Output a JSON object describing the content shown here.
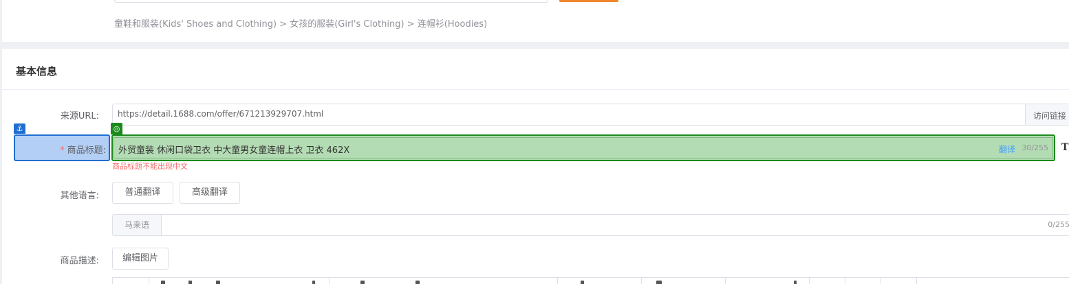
{
  "breadcrumb": "童鞋和服装(Kids' Shoes and Clothing) > 女孩的服装(Girl's Clothing) > 连帽衫(Hoodies)",
  "section": {
    "title": "基本信息"
  },
  "source_url": {
    "label": "来源URL:",
    "value": "https://detail.1688.com/offer/671213929707.html",
    "visit_button": "访问链接"
  },
  "product_title": {
    "required_mark": "*",
    "label": "商品标题:",
    "value": "外贸童装 休闲口袋卫衣 中大童男女童连帽上衣 卫衣 462X",
    "translate": "翻译",
    "count": "30/255",
    "tool_icon": "T",
    "error": "商品标题不能出现中文",
    "anchor_badge": "⚓",
    "target_badge": "◎"
  },
  "other_languages": {
    "label": "其他语言:",
    "normal_translate": "普通翻译",
    "advanced_translate": "高级翻译",
    "language_name": "马来语",
    "language_count": "0/255"
  },
  "description": {
    "label": "商品描述:",
    "edit_images": "编辑图片"
  },
  "colors": {
    "accent_orange": "#f0852d",
    "highlight_blue": "#1f6fd1",
    "highlight_green": "#1b8a1b",
    "error_red": "#f56c6c",
    "link_blue": "#409eff"
  }
}
